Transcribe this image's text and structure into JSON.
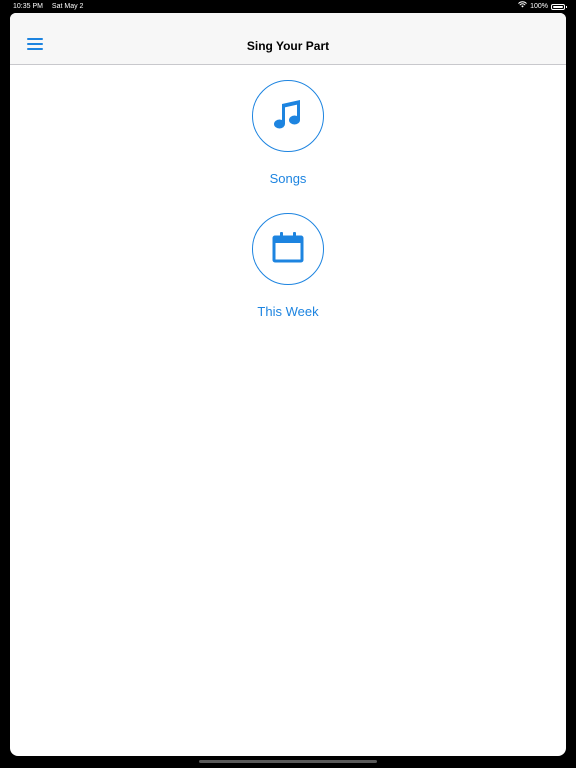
{
  "status_bar": {
    "time": "10:35 PM",
    "date": "Sat May 2",
    "battery": "100%",
    "icons": [
      "wifi-icon",
      "battery-icon"
    ]
  },
  "nav": {
    "title": "Sing Your Part",
    "menu_icon": "hamburger-menu-icon"
  },
  "tiles": [
    {
      "label": "Songs",
      "icon": "music-note-icon"
    },
    {
      "label": "This Week",
      "icon": "calendar-icon"
    }
  ],
  "colors": {
    "accent": "#1d84e0",
    "nav_background": "#f7f7f7",
    "bezel": "#000000"
  }
}
